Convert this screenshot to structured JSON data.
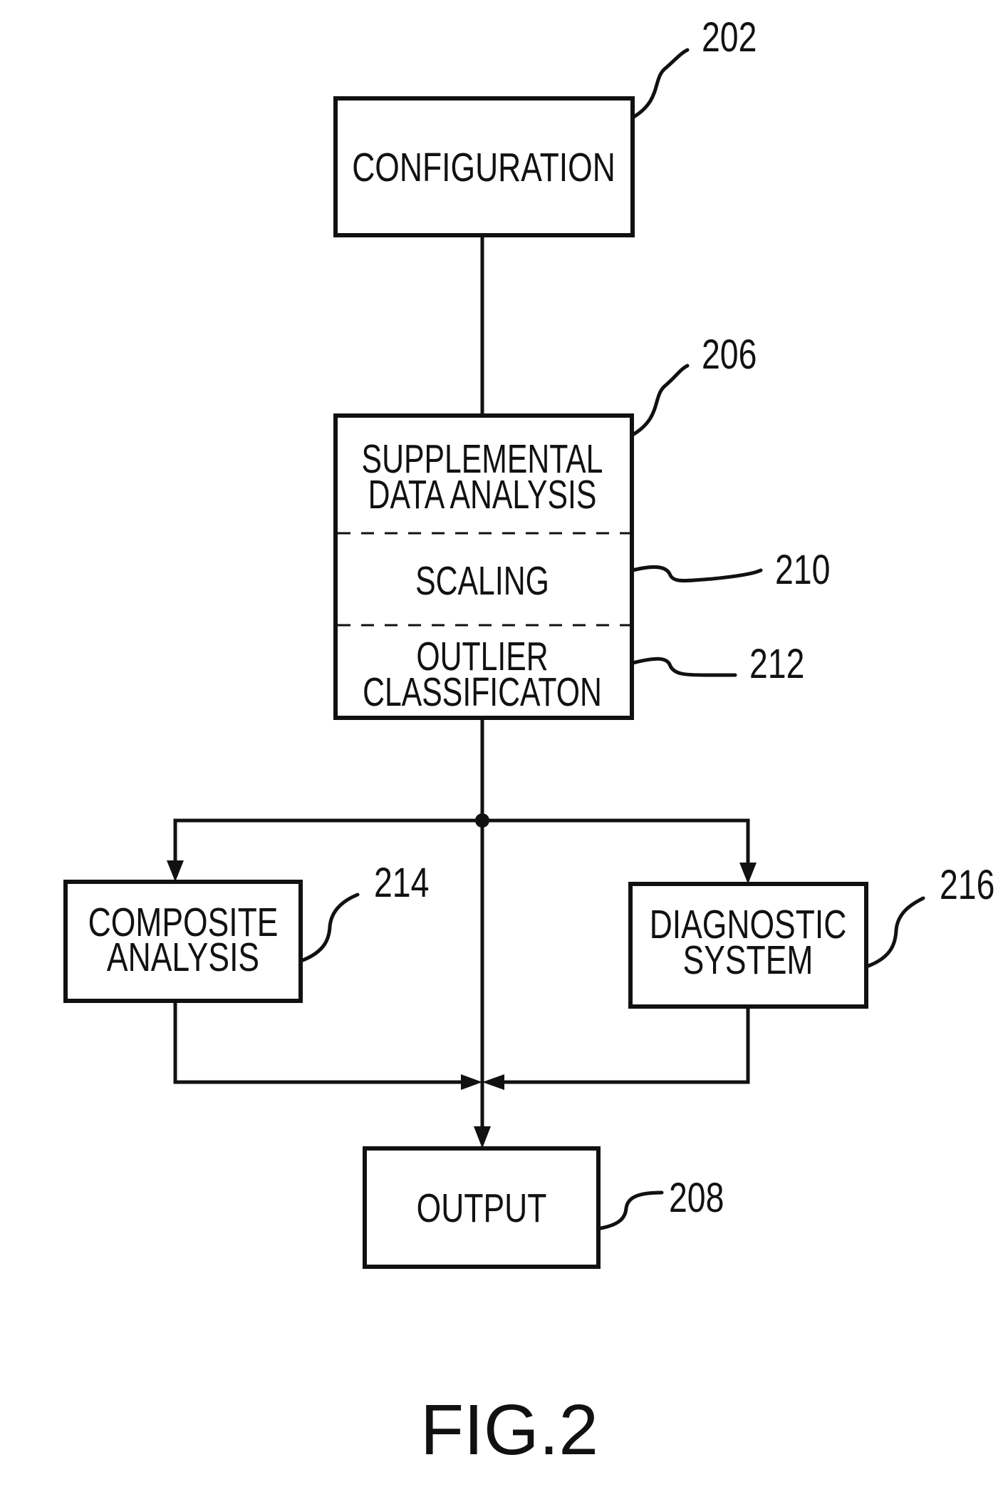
{
  "figure": {
    "caption": "FIG.2",
    "nodes": {
      "configuration": {
        "ref": "202",
        "lines": [
          "CONFIGURATION"
        ]
      },
      "supplemental": {
        "ref": "206",
        "sections": {
          "analysis": {
            "lines": [
              "SUPPLEMENTAL",
              "DATA ANALYSIS"
            ]
          },
          "scaling": {
            "ref": "210",
            "lines": [
              "SCALING"
            ]
          },
          "outlier": {
            "ref": "212",
            "lines": [
              "OUTLIER",
              "CLASSIFICATON"
            ]
          }
        }
      },
      "composite": {
        "ref": "214",
        "lines": [
          "COMPOSITE",
          "ANALYSIS"
        ]
      },
      "diagnostic": {
        "ref": "216",
        "lines": [
          "DIAGNOSTIC",
          "SYSTEM"
        ]
      },
      "output": {
        "ref": "208",
        "lines": [
          "OUTPUT"
        ]
      }
    },
    "edges": [
      {
        "from": "configuration",
        "to": "supplemental",
        "arrow": false
      },
      {
        "from": "supplemental",
        "to": "composite",
        "arrow": true
      },
      {
        "from": "supplemental",
        "to": "diagnostic",
        "arrow": true
      },
      {
        "from": "supplemental",
        "to": "output",
        "arrow": true
      },
      {
        "from": "composite",
        "to": "output",
        "arrow": true
      },
      {
        "from": "diagnostic",
        "to": "output",
        "arrow": true
      }
    ]
  }
}
